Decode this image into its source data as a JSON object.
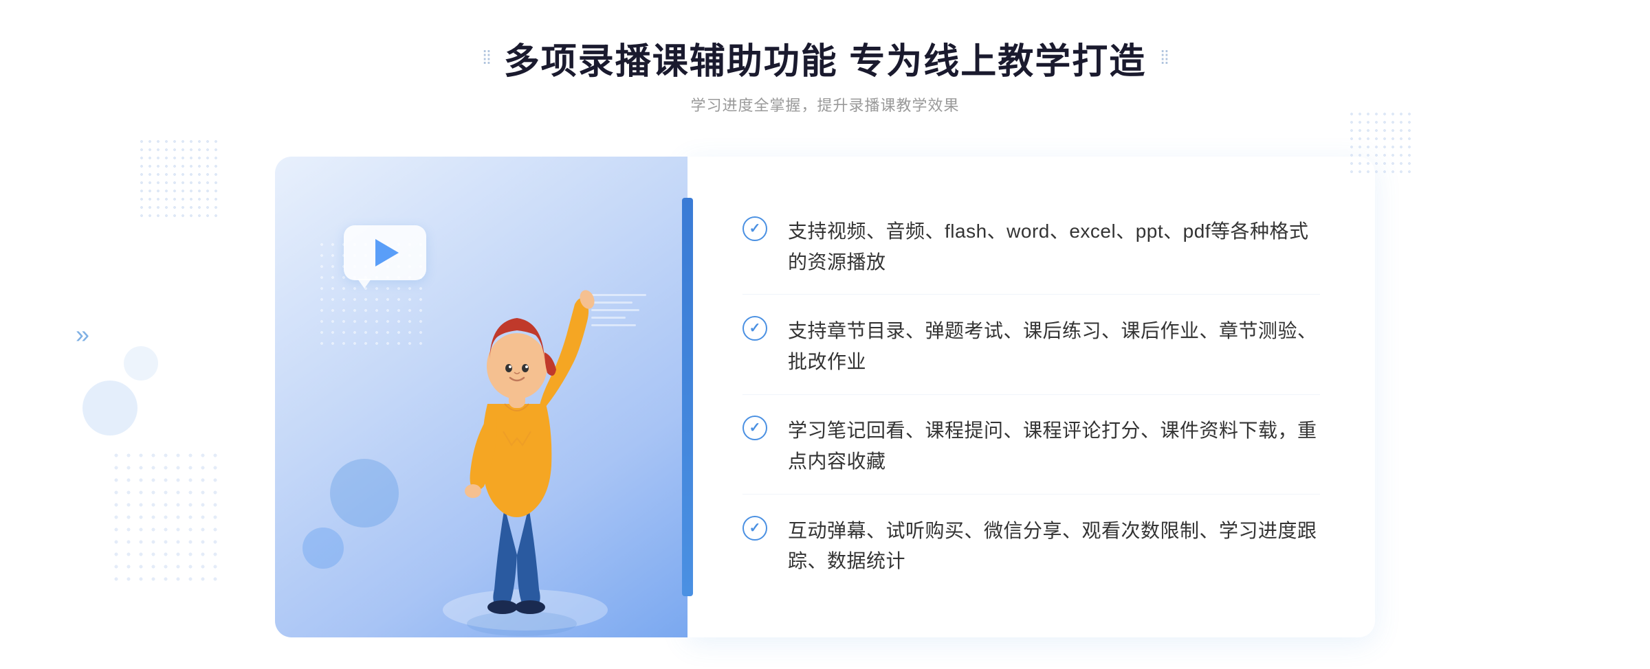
{
  "header": {
    "title": "多项录播课辅助功能 专为线上教学打造",
    "subtitle": "学习进度全掌握，提升录播课教学效果",
    "decorator_left": "⁞⁞",
    "decorator_right": "⁞⁞"
  },
  "features": [
    {
      "id": 1,
      "text": "支持视频、音频、flash、word、excel、ppt、pdf等各种格式的资源播放"
    },
    {
      "id": 2,
      "text": "支持章节目录、弹题考试、课后练习、课后作业、章节测验、批改作业"
    },
    {
      "id": 3,
      "text": "学习笔记回看、课程提问、课程评论打分、课件资料下载，重点内容收藏"
    },
    {
      "id": 4,
      "text": "互动弹幕、试听购买、微信分享、观看次数限制、学习进度跟踪、数据统计"
    }
  ],
  "colors": {
    "accent_blue": "#4a90e2",
    "title_dark": "#1a1a2e",
    "subtitle_gray": "#999999",
    "text_main": "#333333"
  },
  "icons": {
    "check": "✓",
    "chevron_double": "»"
  }
}
